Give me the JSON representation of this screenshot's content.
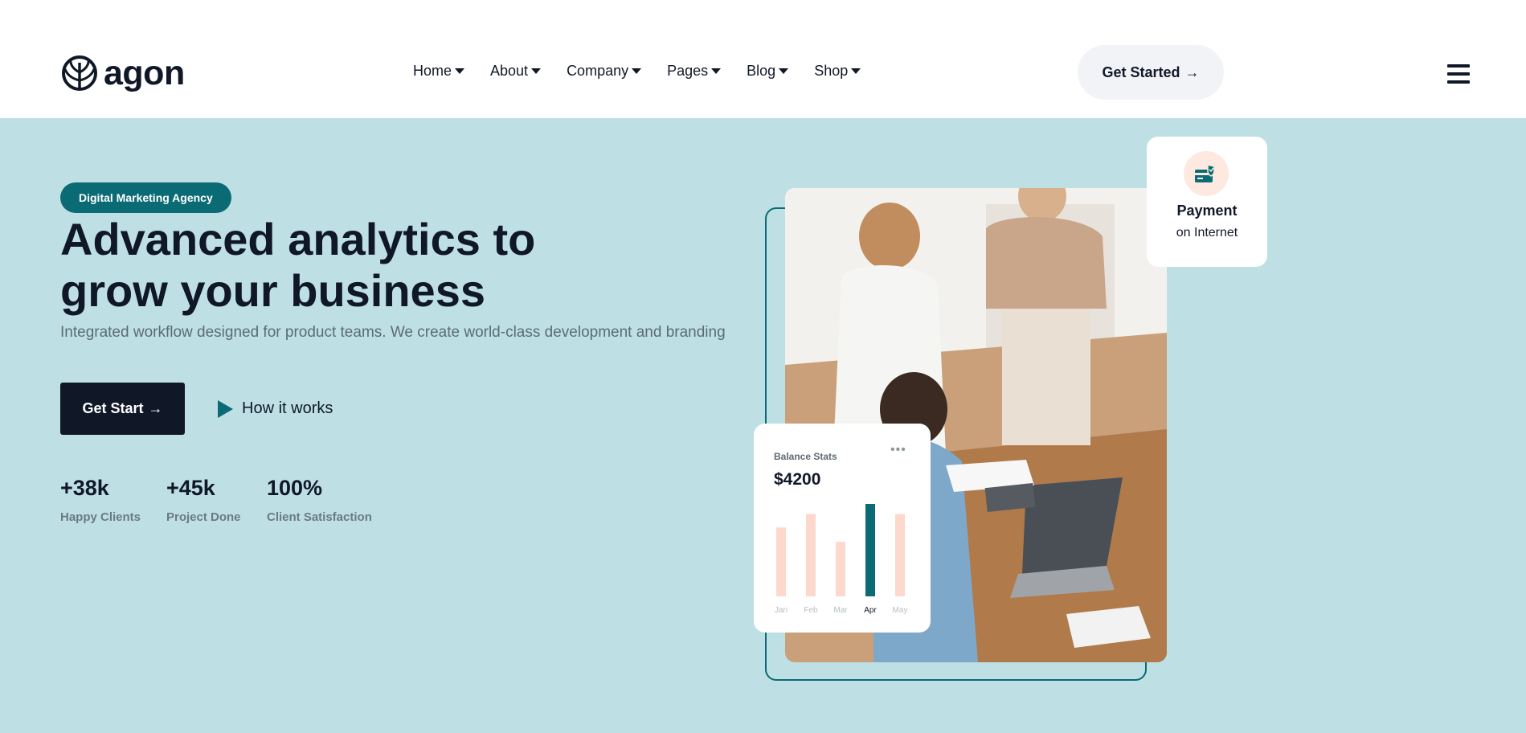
{
  "header": {
    "logo_text": "agon",
    "nav": [
      {
        "label": "Home"
      },
      {
        "label": "About"
      },
      {
        "label": "Company"
      },
      {
        "label": "Pages"
      },
      {
        "label": "Blog"
      },
      {
        "label": "Shop"
      }
    ],
    "cta_label": "Get Started",
    "menu_icon": "hamburger-icon"
  },
  "hero": {
    "badge": "Digital Marketing Agency",
    "title_line1": "Advanced analytics to",
    "title_line2": "grow your business",
    "subtitle": "Integrated workflow designed for product teams. We create world-class development and branding",
    "primary_button": "Get Start",
    "secondary_link": "How it works",
    "stats": [
      {
        "value": "+38k",
        "label": "Happy Clients"
      },
      {
        "value": "+45k",
        "label": "Project Done"
      },
      {
        "value": "100%",
        "label": "Client Satisfaction"
      }
    ]
  },
  "payment_card": {
    "title": "Payment",
    "subtitle": "on Internet",
    "icon": "payment-card-check-icon"
  },
  "balance_card": {
    "title": "Balance Stats",
    "amount": "$4200",
    "menu_icon": "more-dots-icon"
  },
  "chart_data": {
    "type": "bar",
    "title": "Balance Stats",
    "categories": [
      "Jan",
      "Feb",
      "Mar",
      "Apr",
      "May"
    ],
    "values": [
      82,
      98,
      65,
      110,
      98
    ],
    "highlight": "Apr",
    "colors": {
      "default": "#fcd9cc",
      "highlight": "#0b6b75"
    }
  },
  "colors": {
    "accent": "#0b6b75",
    "dark": "#101828",
    "hero_bg": "#bee0e5",
    "muted": "#5c6b73"
  }
}
